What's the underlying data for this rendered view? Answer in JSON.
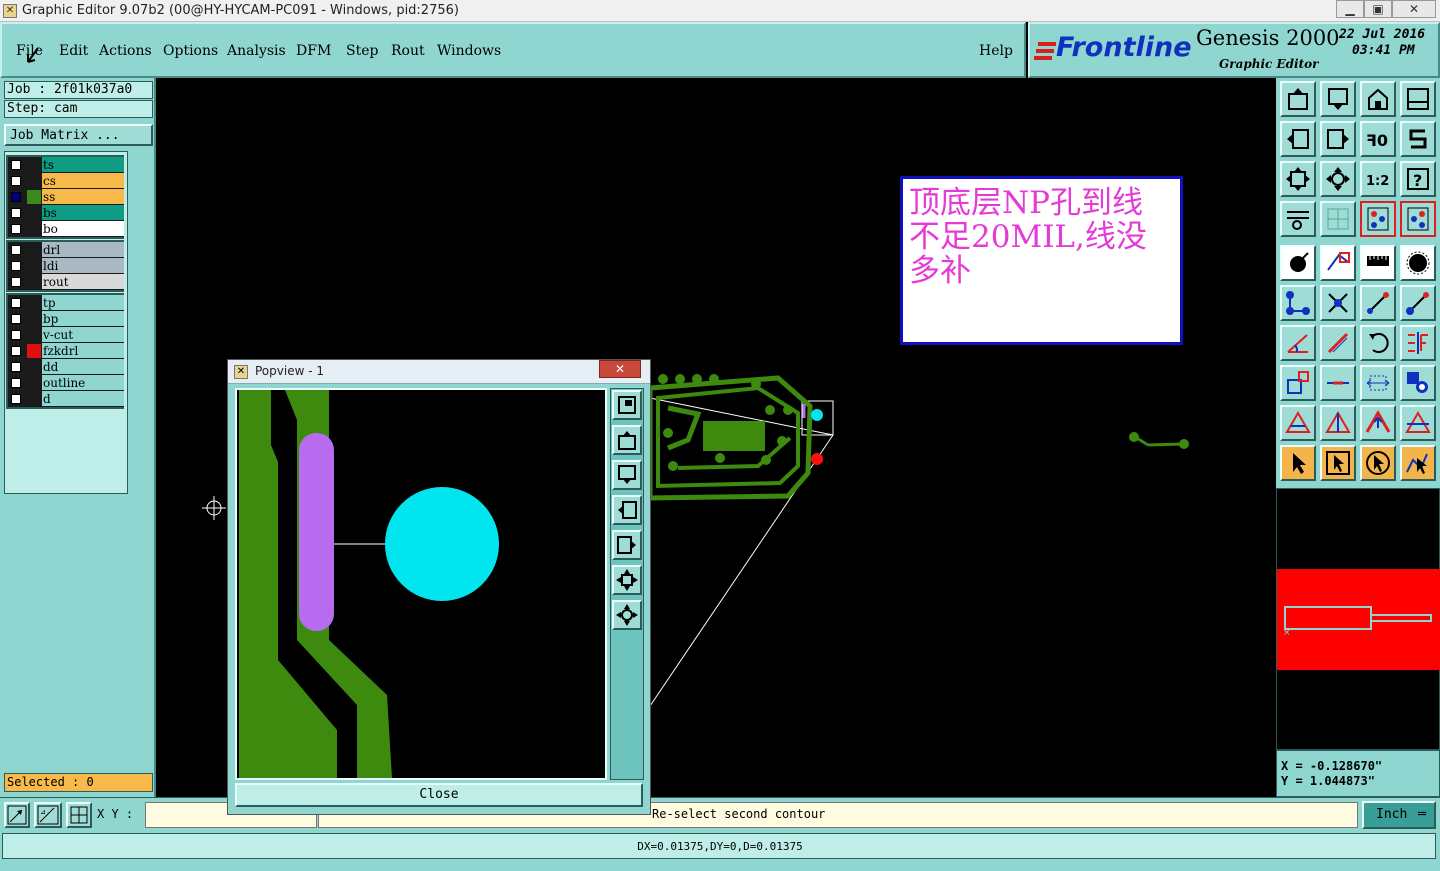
{
  "window": {
    "title": "Graphic Editor 9.07b2 (00@HY-HYCAM-PC091 - Windows, pid:2756)",
    "buttons": [
      "minimize",
      "maximize",
      "close"
    ]
  },
  "menu": {
    "file": "File",
    "edit": "Edit",
    "actions": "Actions",
    "options": "Options",
    "analysis": "Analysis",
    "dfm": "DFM",
    "step": "Step",
    "rout": "Rout",
    "windows": "Windows",
    "help": "Help"
  },
  "brand": {
    "logo": "Frontline",
    "product": "Genesis 2000",
    "subtitle": "Graphic Editor",
    "date": "22 Jul 2016",
    "time": "03:41 PM"
  },
  "job": {
    "job_label": "Job : 2f01k037a0",
    "step_label": "Step: cam",
    "matrix_button": "Job Matrix ..."
  },
  "layers": {
    "group1": [
      {
        "name": "ts",
        "color": "#0e9c84",
        "swatch": "#1a1a1a",
        "checked": false
      },
      {
        "name": "cs",
        "color": "#f6b94a",
        "swatch": "#1a1a1a",
        "checked": false
      },
      {
        "name": "ss",
        "color": "#f6b94a",
        "swatch": "#3a8a1a",
        "checked": true
      },
      {
        "name": "bs",
        "color": "#0e9c84",
        "swatch": "#1a1a1a",
        "checked": false
      },
      {
        "name": "bo",
        "color": "#ffffff",
        "swatch": "#1a1a1a",
        "checked": false
      }
    ],
    "group2": [
      {
        "name": "drl",
        "color": "#a9b9c3",
        "swatch": "#1a1a1a",
        "checked": false
      },
      {
        "name": "ldi",
        "color": "#a9b9c3",
        "swatch": "#1a1a1a",
        "checked": false
      },
      {
        "name": "rout",
        "color": "#d9d9d9",
        "swatch": "#1a1a1a",
        "checked": false
      }
    ],
    "group3": [
      {
        "name": "tp",
        "color": "#8fd6d0",
        "swatch": "#1a1a1a",
        "checked": false
      },
      {
        "name": "bp",
        "color": "#8fd6d0",
        "swatch": "#1a1a1a",
        "checked": false
      },
      {
        "name": "v-cut",
        "color": "#8fd6d0",
        "swatch": "#1a1a1a",
        "checked": false
      },
      {
        "name": "fzkdrl",
        "color": "#8fd6d0",
        "swatch": "#e01010",
        "checked": false
      },
      {
        "name": "dd",
        "color": "#8fd6d0",
        "swatch": "#1a1a1a",
        "checked": false
      },
      {
        "name": "outline",
        "color": "#8fd6d0",
        "swatch": "#1a1a1a",
        "checked": false
      },
      {
        "name": "d",
        "color": "#8fd6d0",
        "swatch": "#1a1a1a",
        "checked": false
      }
    ]
  },
  "selected": "Selected : 0",
  "annotation": {
    "line1": "顶底层NP孔到线",
    "line2": "不足20MIL,线没",
    "line3": "多补"
  },
  "popview": {
    "title": "Popview - 1",
    "close_label": "Close"
  },
  "coords": {
    "x": "X = -0.128670\"",
    "y": "Y = 1.044873\""
  },
  "status": {
    "xy_label": "X Y :",
    "xy_value": "",
    "prompt": "Re-select second contour",
    "units": "Inch",
    "measure": "DX=0.01375,DY=0,D=0.01375"
  },
  "colors": {
    "panel": "#8fd6d0",
    "copper": "#3d8a0e",
    "drill": "#00e5ee",
    "slot": "#b76cf0",
    "annotation_text": "#e63ad6",
    "highlight": "#ff0000"
  }
}
